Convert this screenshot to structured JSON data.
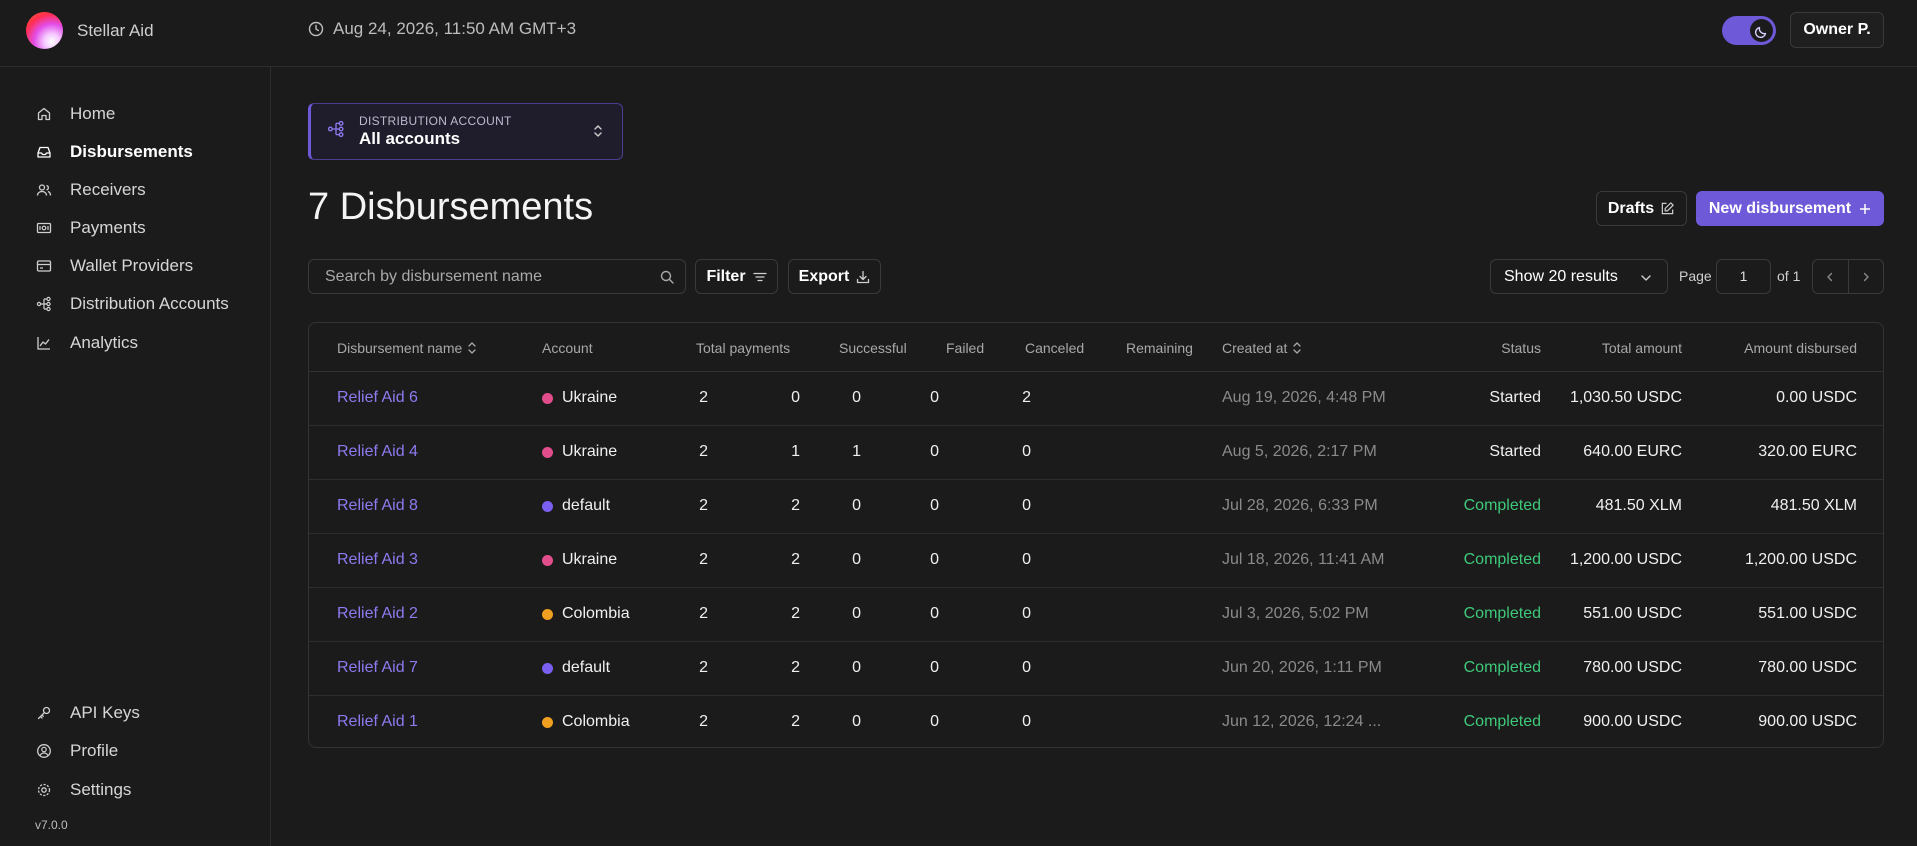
{
  "app": {
    "name": "Stellar Aid",
    "datetime": "Aug 24, 2026, 11:50 AM GMT+3",
    "user_button": "Owner P."
  },
  "sidebar": {
    "items": [
      {
        "label": "Home",
        "icon": "home-icon"
      },
      {
        "label": "Disbursements",
        "icon": "inbox-icon",
        "active": true
      },
      {
        "label": "Receivers",
        "icon": "users-icon"
      },
      {
        "label": "Payments",
        "icon": "payments-icon"
      },
      {
        "label": "Wallet Providers",
        "icon": "wallet-icon"
      },
      {
        "label": "Distribution Accounts",
        "icon": "network-icon"
      },
      {
        "label": "Analytics",
        "icon": "chart-line-icon"
      }
    ],
    "bottom_items": [
      {
        "label": "API Keys",
        "icon": "key-icon"
      },
      {
        "label": "Profile",
        "icon": "user-circle-icon"
      },
      {
        "label": "Settings",
        "icon": "gear-icon"
      }
    ],
    "version": "v7.0.0"
  },
  "account_selector": {
    "label": "DISTRIBUTION ACCOUNT",
    "value": "All accounts"
  },
  "page": {
    "title": "7 Disbursements",
    "drafts_label": "Drafts",
    "new_label": "New disbursement"
  },
  "toolbar": {
    "search_placeholder": "Search by disbursement name",
    "filter_label": "Filter",
    "export_label": "Export",
    "show_results": "Show 20 results",
    "page_label": "Page",
    "page_value": "1",
    "page_of": "of 1"
  },
  "table": {
    "columns": [
      "Disbursement name",
      "Account",
      "Total payments",
      "Successful",
      "Failed",
      "Canceled",
      "Remaining",
      "Created at",
      "Status",
      "Total amount",
      "Amount disbursed"
    ],
    "rows": [
      {
        "name": "Relief Aid 6",
        "account": "Ukraine",
        "total": "2",
        "successful": "0",
        "failed": "0",
        "canceled": "0",
        "remaining": "2",
        "created": "Aug 19, 2026, 4:48 PM",
        "status": "Started",
        "amount": "1,030.50 USDC",
        "disbursed": "0.00 USDC"
      },
      {
        "name": "Relief Aid 4",
        "account": "Ukraine",
        "total": "2",
        "successful": "1",
        "failed": "1",
        "canceled": "0",
        "remaining": "0",
        "created": "Aug 5, 2026, 2:17 PM",
        "status": "Started",
        "amount": "640.00 EURC",
        "disbursed": "320.00 EURC"
      },
      {
        "name": "Relief Aid 8",
        "account": "default",
        "total": "2",
        "successful": "2",
        "failed": "0",
        "canceled": "0",
        "remaining": "0",
        "created": "Jul 28, 2026, 6:33 PM",
        "status": "Completed",
        "amount": "481.50 XLM",
        "disbursed": "481.50 XLM"
      },
      {
        "name": "Relief Aid 3",
        "account": "Ukraine",
        "total": "2",
        "successful": "2",
        "failed": "0",
        "canceled": "0",
        "remaining": "0",
        "created": "Jul 18, 2026, 11:41 AM",
        "status": "Completed",
        "amount": "1,200.00 USDC",
        "disbursed": "1,200.00 USDC"
      },
      {
        "name": "Relief Aid 2",
        "account": "Colombia",
        "total": "2",
        "successful": "2",
        "failed": "0",
        "canceled": "0",
        "remaining": "0",
        "created": "Jul 3, 2026, 5:02 PM",
        "status": "Completed",
        "amount": "551.00 USDC",
        "disbursed": "551.00 USDC"
      },
      {
        "name": "Relief Aid 7",
        "account": "default",
        "total": "2",
        "successful": "2",
        "failed": "0",
        "canceled": "0",
        "remaining": "0",
        "created": "Jun 20, 2026, 1:11 PM",
        "status": "Completed",
        "amount": "780.00 USDC",
        "disbursed": "780.00 USDC"
      },
      {
        "name": "Relief Aid 1",
        "account": "Colombia",
        "total": "2",
        "successful": "2",
        "failed": "0",
        "canceled": "0",
        "remaining": "0",
        "created": "Jun 12, 2026, 12:24 ...",
        "status": "Completed",
        "amount": "900.00 USDC",
        "disbursed": "900.00 USDC"
      }
    ]
  },
  "colors": {
    "accent": "#6e59d9",
    "link": "#8e7af0",
    "completed": "#3fc97a",
    "account_ukraine": "#e24d8c",
    "account_default": "#7a5ff0",
    "account_colombia": "#f0a020"
  }
}
